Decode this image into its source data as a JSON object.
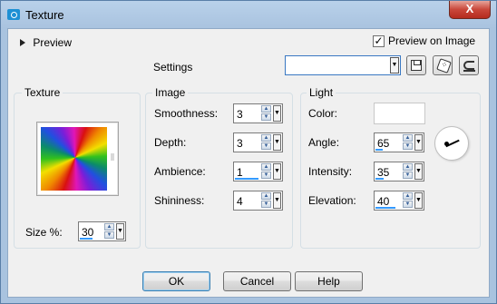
{
  "window": {
    "title": "Texture",
    "close_label": "X"
  },
  "preview": {
    "toggle_label": "Preview",
    "preview_on_image_label": "Preview on Image",
    "preview_on_image_checked": true
  },
  "settings": {
    "label": "Settings",
    "value": ""
  },
  "texture": {
    "group_label": "Texture",
    "size_label": "Size %:",
    "size_value": "30"
  },
  "image": {
    "group_label": "Image",
    "smoothness": {
      "label": "Smoothness:",
      "value": "3"
    },
    "depth": {
      "label": "Depth:",
      "value": "3"
    },
    "ambience": {
      "label": "Ambience:",
      "value": "1"
    },
    "shininess": {
      "label": "Shininess:",
      "value": "4"
    }
  },
  "light": {
    "group_label": "Light",
    "color": {
      "label": "Color:",
      "value": "#ffffff"
    },
    "angle": {
      "label": "Angle:",
      "value": "65"
    },
    "intensity": {
      "label": "Intensity:",
      "value": "35"
    },
    "elevation": {
      "label": "Elevation:",
      "value": "40"
    }
  },
  "buttons": {
    "ok": "OK",
    "cancel": "Cancel",
    "help": "Help"
  },
  "icons": [
    "camera-icon",
    "save-preset-icon",
    "randomize-dice-icon",
    "reset-icon",
    "angle-dial-icon"
  ]
}
